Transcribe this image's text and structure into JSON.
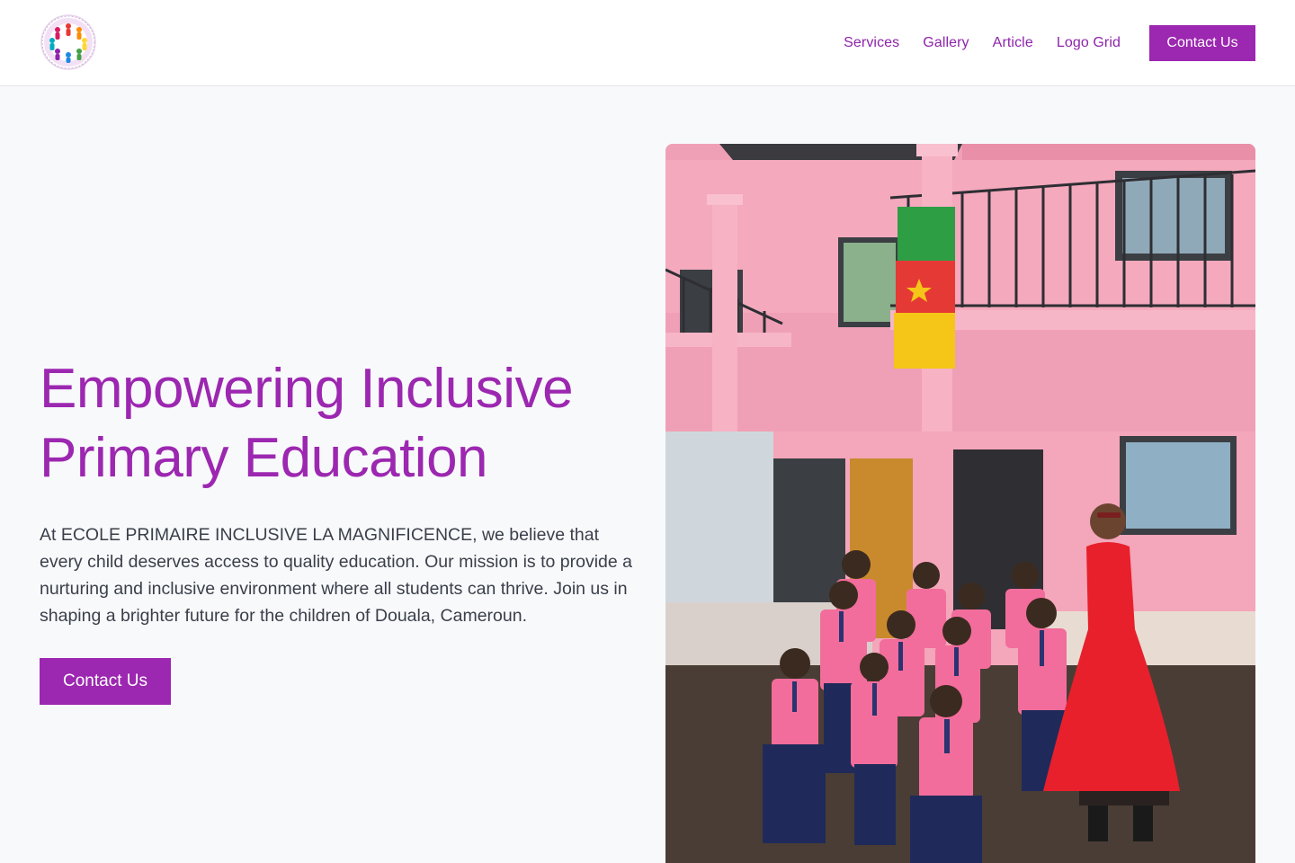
{
  "header": {
    "nav": [
      "Services",
      "Gallery",
      "Article",
      "Logo Grid"
    ],
    "cta_label": "Contact Us"
  },
  "hero": {
    "title_line1": "Empowering Inclusive",
    "title_line2": "Primary Education",
    "description": "At ECOLE PRIMAIRE INCLUSIVE LA MAGNIFICENCE, we believe that every child deserves access to quality education. Our mission is to provide a nurturing and inclusive environment where all students can thrive. Join us in shaping a brighter future for the children of Douala, Cameroun.",
    "cta_label": "Contact Us"
  },
  "colors": {
    "brand": "#9c27b0",
    "background": "#f8f9fb",
    "text": "#3a3f4a"
  },
  "icons": {
    "logo": "school-logo-children-circle"
  }
}
